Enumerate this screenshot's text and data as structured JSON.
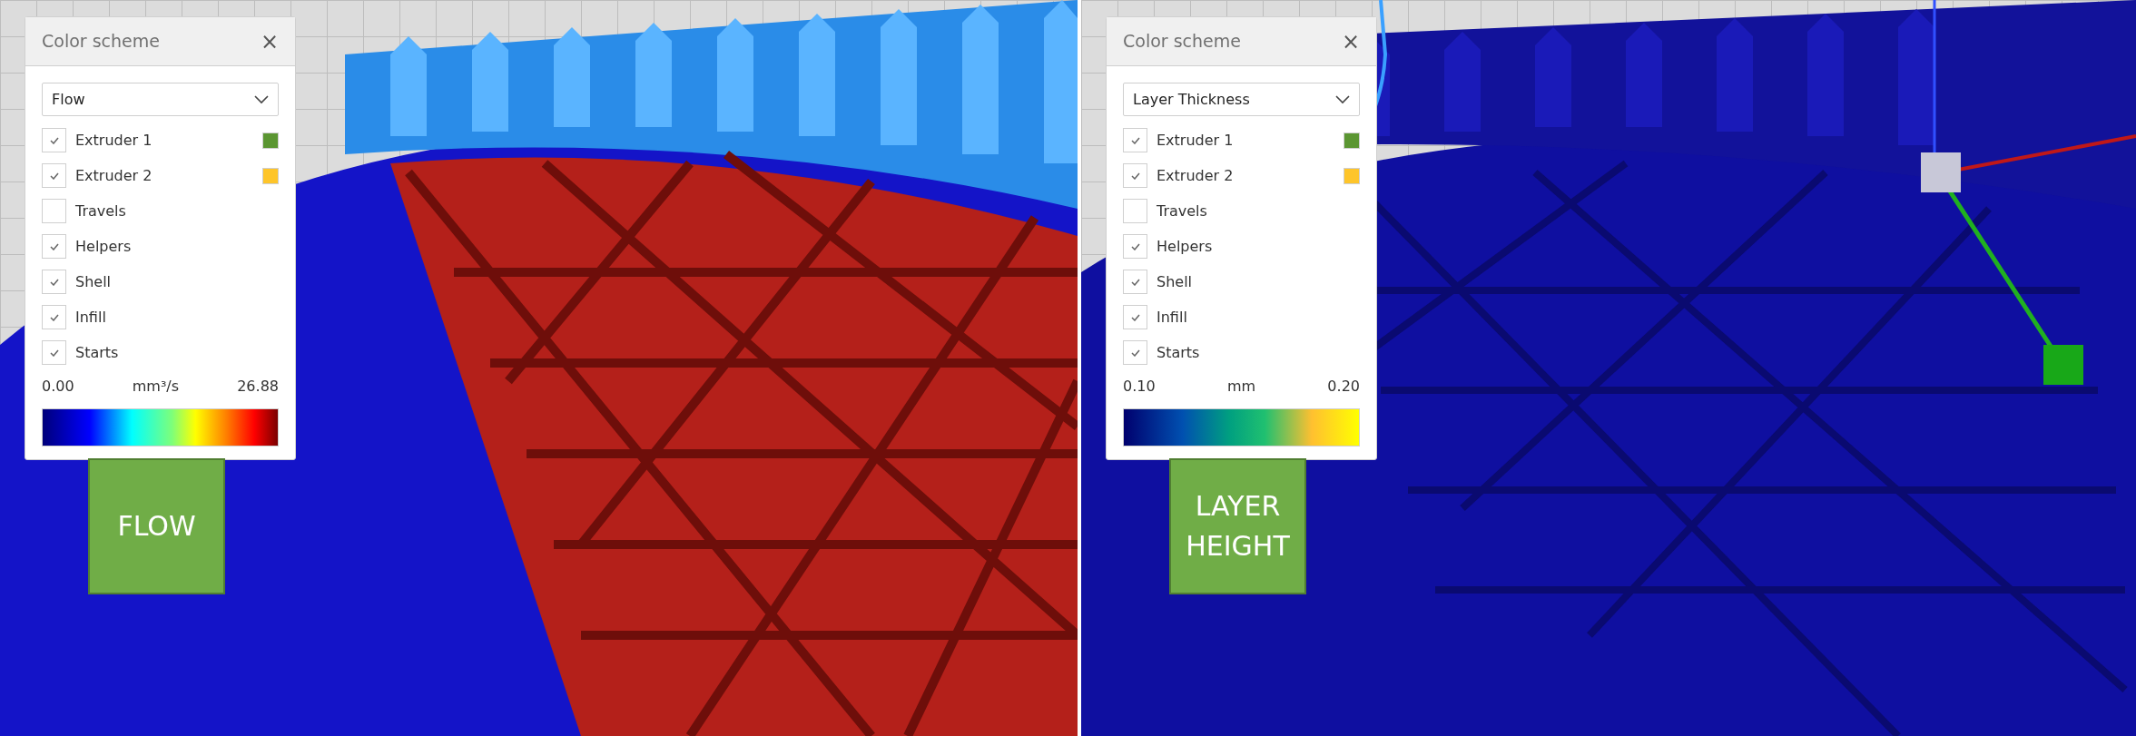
{
  "views": [
    {
      "kind": "flow",
      "color_scheme": {
        "title": "Color scheme",
        "close": "×",
        "mode": "Flow",
        "layers": [
          {
            "label": "Extruder 1",
            "checked": true,
            "color": "#5b9632"
          },
          {
            "label": "Extruder 2",
            "checked": true,
            "color": "#fec52a"
          },
          {
            "label": "Travels",
            "checked": false
          },
          {
            "label": "Helpers",
            "checked": true
          },
          {
            "label": "Shell",
            "checked": true
          },
          {
            "label": "Infill",
            "checked": true
          },
          {
            "label": "Starts",
            "checked": true
          }
        ],
        "range_min": "0.00",
        "unit": "mm³/s",
        "range_max": "26.88"
      },
      "caption": "FLOW"
    },
    {
      "kind": "layer_thickness",
      "color_scheme": {
        "title": "Color scheme",
        "close": "×",
        "mode": "Layer Thickness",
        "layers": [
          {
            "label": "Extruder 1",
            "checked": true,
            "color": "#5b9632"
          },
          {
            "label": "Extruder 2",
            "checked": true,
            "color": "#fec52a"
          },
          {
            "label": "Travels",
            "checked": false
          },
          {
            "label": "Helpers",
            "checked": true
          },
          {
            "label": "Shell",
            "checked": true
          },
          {
            "label": "Infill",
            "checked": true
          },
          {
            "label": "Starts",
            "checked": true
          }
        ],
        "range_min": "0.10",
        "unit": "mm",
        "range_max": "0.20"
      },
      "caption": "LAYER HEIGHT"
    }
  ]
}
